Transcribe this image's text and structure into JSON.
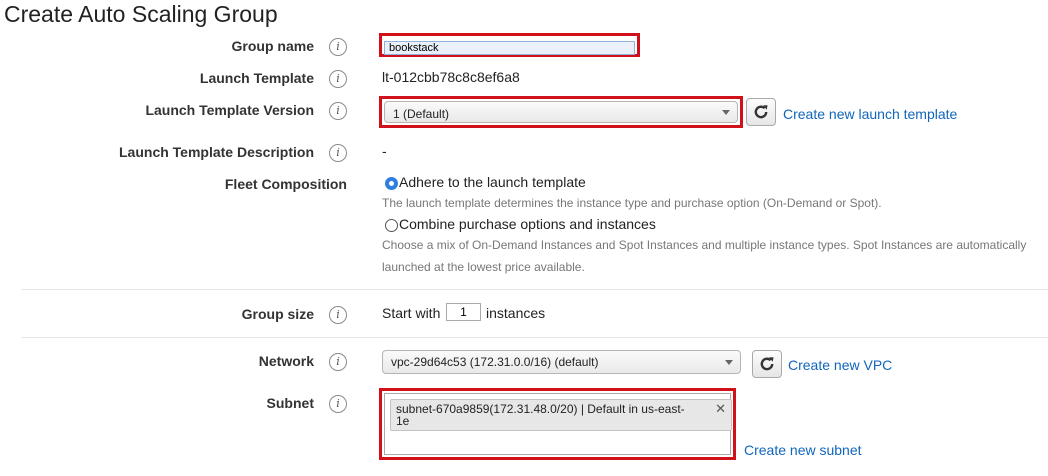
{
  "page": {
    "title": "Create Auto Scaling Group"
  },
  "fields": {
    "group_name": {
      "label": "Group name",
      "value": "bookstack"
    },
    "launch_template": {
      "label": "Launch Template",
      "value": "lt-012cbb78c8c8ef6a8"
    },
    "launch_template_version": {
      "label": "Launch Template Version",
      "selected": "1 (Default)",
      "link": "Create new launch template"
    },
    "launch_template_description": {
      "label": "Launch Template Description",
      "value": "-"
    },
    "fleet_composition": {
      "label": "Fleet Composition",
      "options": [
        {
          "label": "Adhere to the launch template",
          "selected": true,
          "help": "The launch template determines the instance type and purchase option (On-Demand or Spot)."
        },
        {
          "label": "Combine purchase options and instances",
          "selected": false,
          "help_line1": "Choose a mix of On-Demand Instances and Spot Instances and multiple instance types. Spot Instances are automatically",
          "help_line2": "launched at the lowest price available."
        }
      ]
    },
    "group_size": {
      "label": "Group size",
      "prefix": "Start with",
      "value": "1",
      "suffix": "instances"
    },
    "network": {
      "label": "Network",
      "selected": "vpc-29d64c53 (172.31.0.0/16) (default)",
      "link": "Create new VPC"
    },
    "subnet": {
      "label": "Subnet",
      "token_line1": "subnet-670a9859(172.31.48.0/20) | Default in us-east-",
      "token_line2": "1e",
      "link": "Create new subnet"
    }
  },
  "icons": {
    "info": "info-icon",
    "refresh": "refresh-icon",
    "remove": "close-icon",
    "dropdown": "chevron-down-icon"
  },
  "colors": {
    "highlight": "#d0101a",
    "link": "#1166bb",
    "radio_selected": "#2f7fe0"
  }
}
